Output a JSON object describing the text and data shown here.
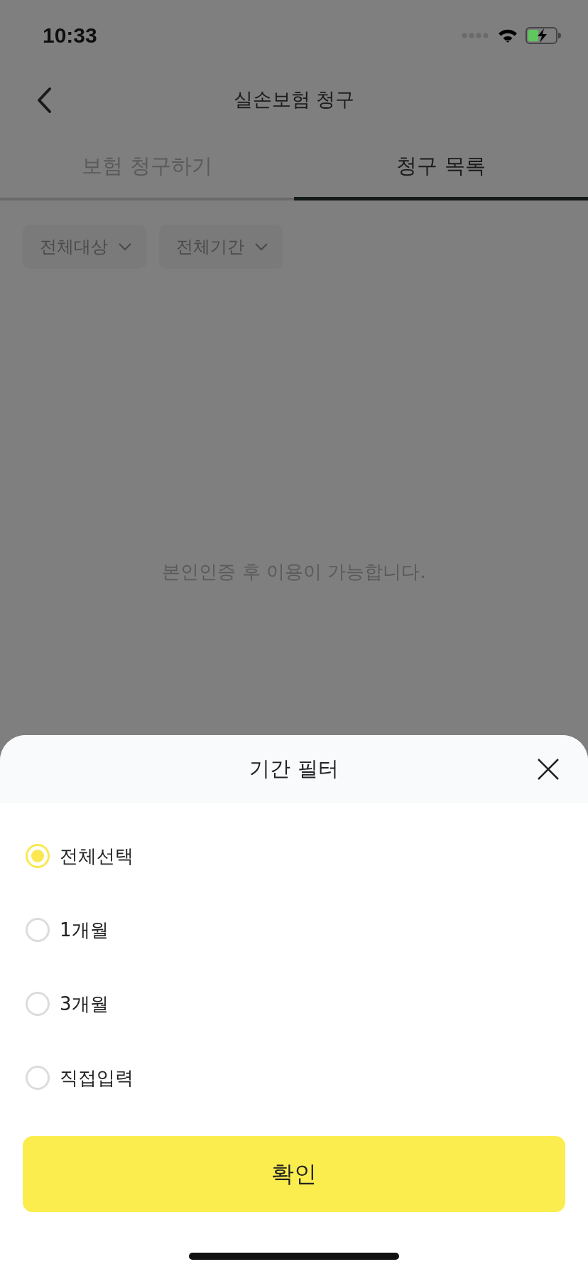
{
  "status_bar": {
    "time": "10:33"
  },
  "nav": {
    "title": "실손보험 청구"
  },
  "tabs": [
    {
      "label": "보험 청구하기",
      "selected": false
    },
    {
      "label": "청구 목록",
      "selected": true
    }
  ],
  "filters": [
    {
      "label": "전체대상"
    },
    {
      "label": "전체기간"
    }
  ],
  "empty_message": "본인인증 후 이용이 가능합니다.",
  "sheet": {
    "title": "기간 필터",
    "options": [
      {
        "label": "전체선택",
        "selected": true
      },
      {
        "label": "1개월",
        "selected": false
      },
      {
        "label": "3개월",
        "selected": false
      },
      {
        "label": "직접입력",
        "selected": false
      }
    ],
    "confirm": "확인"
  }
}
